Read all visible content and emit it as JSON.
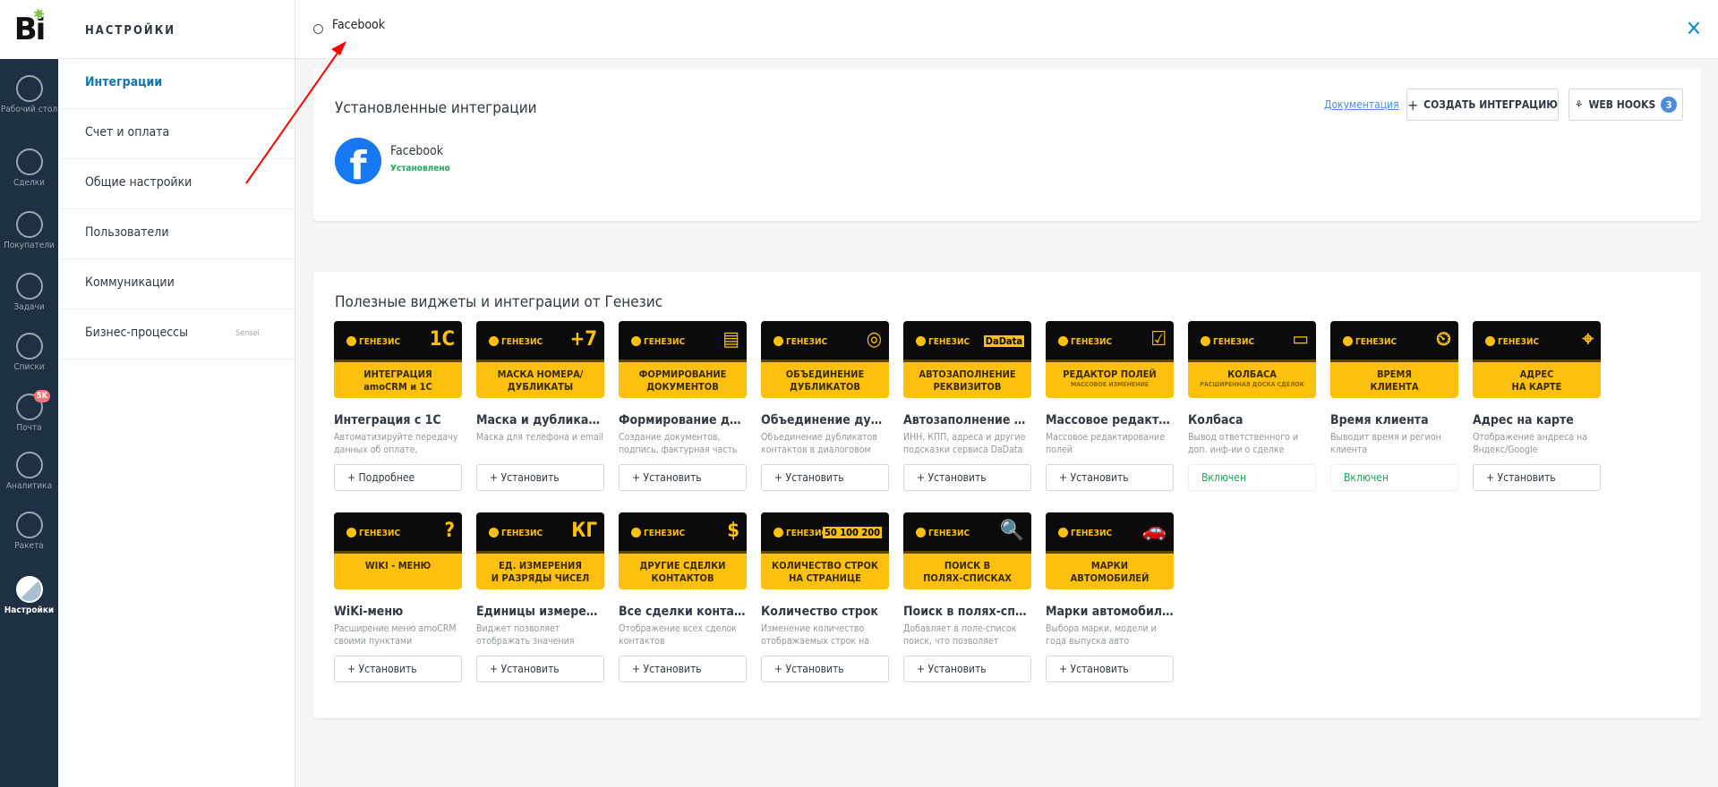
{
  "logo": "Bi",
  "leftnav": [
    {
      "label": "Рабочий стол",
      "icon": "dashboard-icon"
    },
    {
      "label": "Сделки",
      "icon": "deals-icon"
    },
    {
      "label": "Покупатели",
      "icon": "customers-icon"
    },
    {
      "label": "Задачи",
      "icon": "tasks-icon"
    },
    {
      "label": "Списки",
      "icon": "lists-icon"
    },
    {
      "label": "Почта",
      "icon": "mail-icon",
      "badge": "5K"
    },
    {
      "label": "Аналитика",
      "icon": "analytics-icon"
    },
    {
      "label": "Ракета",
      "icon": "rocket-icon"
    },
    {
      "label": "Настройки",
      "icon": "settings-icon",
      "active": true
    }
  ],
  "settings": {
    "title": "НАСТРОЙКИ",
    "items": [
      {
        "label": "Интеграции",
        "active": true
      },
      {
        "label": "Счет и оплата"
      },
      {
        "label": "Общие настройки"
      },
      {
        "label": "Пользователи"
      },
      {
        "label": "Коммуникации"
      },
      {
        "label": "Бизнес-процессы",
        "tag": "Sensei"
      }
    ]
  },
  "search": {
    "value": "Facebook"
  },
  "installed": {
    "title": "Установленные интеграции",
    "doc_link": "Документация",
    "create_label": "СОЗДАТЬ ИНТЕГРАЦИЮ",
    "webhooks_label": "WEB HOOKS",
    "webhooks_count": "3",
    "items": [
      {
        "name": "Facebook",
        "status": "Установлено"
      }
    ]
  },
  "widgets": {
    "title": "Полезные виджеты и интеграции от Генезис",
    "brand": "ГЕНЕЗИС",
    "accent": "#fec00f",
    "items": [
      {
        "glyph": "1С",
        "cap": "ИНТЕГРАЦИЯ",
        "cap2": "amoCRM и 1С",
        "title": "Интеграция с 1С",
        "desc": "Автоматизируйте передачу данных об оплате,",
        "button": "Подробнее"
      },
      {
        "glyph": "+7",
        "cap": "МАСКА НОМЕРА/",
        "cap2": "ДУБЛИКАТЫ",
        "title": "Маска и дубликаты",
        "desc": "Маска для телефона и email",
        "button": "Установить"
      },
      {
        "glyph": "▤",
        "cap": "ФОРМИРОВАНИЕ",
        "cap2": "ДОКУМЕНТОВ",
        "title": "Формирование документов",
        "desc": "Создание документов, подпись, фактурная часть",
        "button": "Установить"
      },
      {
        "glyph": "◎",
        "cap": "ОБЪЕДИНЕНИЕ",
        "cap2": "ДУБЛИКАТОВ",
        "title": "Объединение дубликатов",
        "desc": "Объединение дубликатов контактов в диалоговом",
        "button": "Установить"
      },
      {
        "glyph": "DaData",
        "cap": "АВТОЗАПОЛНЕНИЕ",
        "cap2": "РЕКВИЗИТОВ",
        "title": "Автозаполнение реквизитов",
        "desc": "ИНН, КПП, адреса и другие подсказки сервиса DaData",
        "button": "Установить"
      },
      {
        "glyph": "☑",
        "cap": "РЕДАКТОР ПОЛЕЙ",
        "small": "МАССОВОЕ ИЗМЕНЕНИЕ",
        "title": "Массовое редактирование",
        "desc": "Массовое редактирование полей",
        "button": "Установить"
      },
      {
        "glyph": "▭",
        "cap": "КОЛБАСА",
        "small": "РАСШИРЕННАЯ ДОСКА СДЕЛОК",
        "title": "Колбаса",
        "desc": "Вывод ответственного и доп. инф-ии о сделке",
        "button": "Включен",
        "enabled": true
      },
      {
        "glyph": "⏲",
        "cap": "ВРЕМЯ",
        "cap2": "КЛИЕНТА",
        "title": "Время клиента",
        "desc": "Выводит время и регион клиента",
        "button": "Включен",
        "enabled": true
      },
      {
        "glyph": "⌖",
        "cap": "АДРЕС",
        "cap2": "НА КАРТЕ",
        "title": "Адрес на карте",
        "desc": "Отображение андреса на Яндекс/Google",
        "button": "Установить"
      },
      {
        "glyph": "?",
        "cap": "WIKI - МЕНЮ",
        "title": "WiKi-меню",
        "desc": "Расширение меню amoCRM своими пунктами",
        "button": "Установить"
      },
      {
        "glyph": "КГ",
        "cap": "ЕД. ИЗМЕРЕНИЯ",
        "cap2": "И РАЗРЯДЫ ЧИСЕЛ",
        "title": "Единицы измерения",
        "desc": "Виджет позволяет отображать значения",
        "button": "Установить"
      },
      {
        "glyph": "$",
        "cap": "ДРУГИЕ СДЕЛКИ",
        "cap2": "КОНТАКТОВ",
        "title": "Все сделки контактов",
        "desc": "Отображение всех сделок контактов",
        "button": "Установить"
      },
      {
        "glyph": "50 100 200",
        "cap": "КОЛИЧЕСТВО СТРОК",
        "cap2": "НА СТРАНИЦЕ",
        "title": "Количество строк",
        "desc": "Изменение количество отображаемых строк на",
        "button": "Установить"
      },
      {
        "glyph": "🔍",
        "cap": "ПОИСК В",
        "cap2": "ПОЛЯХ-СПИСКАХ",
        "title": "Поиск в полях-списках",
        "desc": "Добавляет в поле-список поиск, что позволяет",
        "button": "Установить"
      },
      {
        "glyph": "🚗",
        "cap": "МАРКИ",
        "cap2": "АВТОМОБИЛЕЙ",
        "title": "Марки автомобилей",
        "desc": "Выбора марки, модели и года выпуска авто",
        "button": "Установить"
      }
    ]
  }
}
